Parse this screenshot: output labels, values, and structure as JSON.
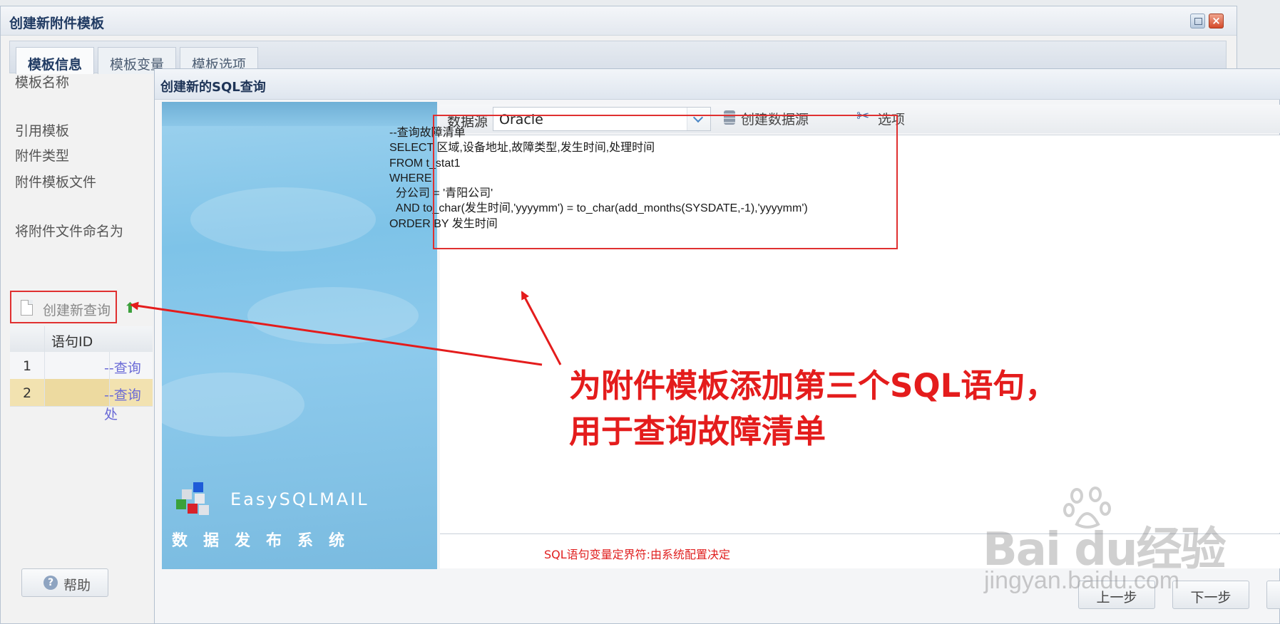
{
  "outer_window": {
    "title": "创建新附件模板",
    "tabs": [
      "模板信息",
      "模板变量",
      "模板选项"
    ],
    "fields": {
      "template_name": "模板名称",
      "ref_template": "引用模板",
      "attach_type": "附件类型",
      "attach_file": "附件模板文件",
      "name_as": "将附件文件命名为"
    },
    "toolbar": {
      "create_query": "创建新查询"
    },
    "grid": {
      "header": "语句ID",
      "rows": [
        {
          "num": "1",
          "sql": "--查询上"
        },
        {
          "num": "2",
          "sql": "--查询处"
        }
      ]
    },
    "help_label": "帮助"
  },
  "dialog": {
    "title": "创建新的SQL查询",
    "datasource_label": "数据源",
    "datasource_value": "Oracle",
    "create_datasource": "创建数据源",
    "options": "选项",
    "sql_text": "--查询故障清单\nSELECT 区域,设备地址,故障类型,发生时间,处理时间\nFROM t_stat1\nWHERE\n  分公司 = '青阳公司'\n  AND to_char(发生时间,'yyyymm') = to_char(add_months(SYSDATE,-1),'yyyymm')\nORDER BY 发生时间",
    "footnote": "SQL语句变量定界符:由系统配置决定",
    "prev_button": "上一步",
    "next_button": "下一步",
    "brand_name": "EasySQLMAIL",
    "brand_sub": "数据发布系统"
  },
  "annotation": {
    "line1": "为附件模板添加第三个SQL语句，",
    "line2": "用于查询故障清单"
  },
  "watermark": {
    "logo": "Bai du经验",
    "url": "jingyan.baidu.com"
  },
  "colors": {
    "annotation_red": "#e41c1c",
    "title_blue": "#213b63",
    "link_purple": "#6a6ad6"
  }
}
